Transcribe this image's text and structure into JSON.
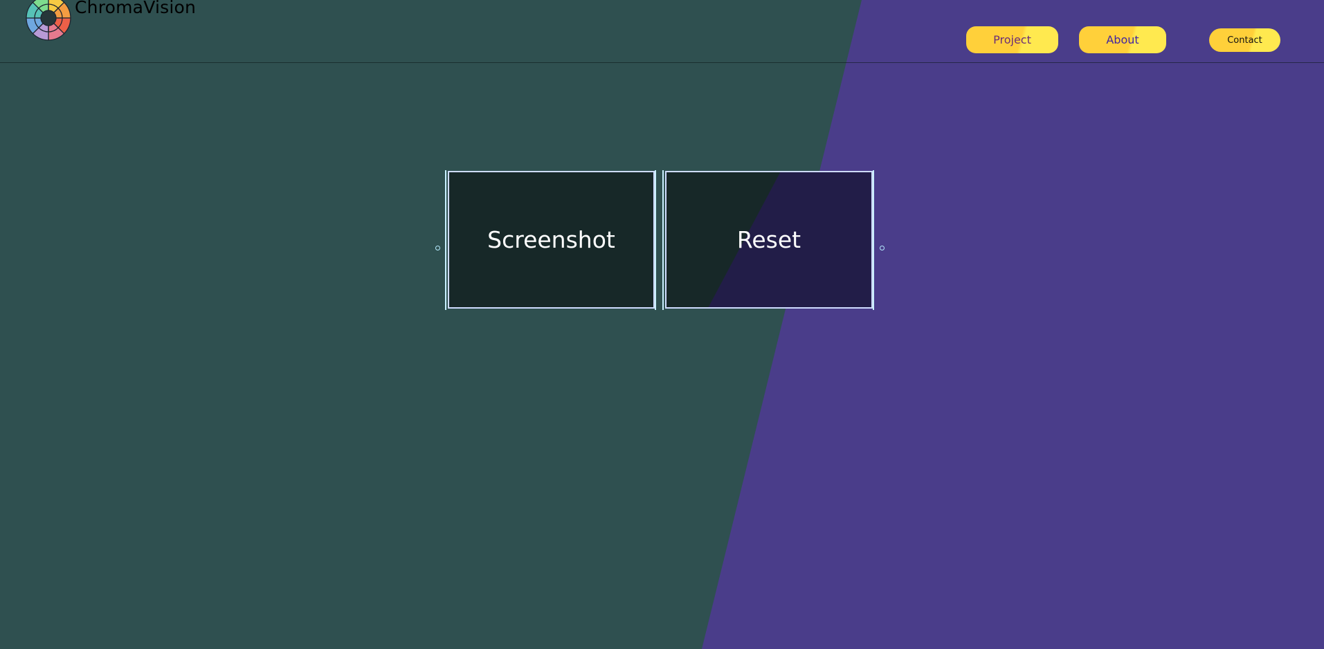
{
  "header": {
    "brand": {
      "name": "ChromaVision",
      "logo_icon": "color-wheel-icon"
    },
    "nav": {
      "project_label": "Project",
      "about_label": "About",
      "contact_label": "Contact"
    }
  },
  "controls": {
    "screenshot_label": "Screenshot",
    "reset_label": "Reset",
    "left_handle_icon": "selection-handle-icon",
    "right_handle_icon": "selection-handle-icon"
  },
  "colors": {
    "background_teal": "#2f5050",
    "background_purple": "#4a3d8a",
    "nav_yellow": "#ffd03a",
    "nav_highlight": "#ffe94f",
    "button_dark": "#172828",
    "button_purple_dark": "#221d48",
    "outline_blue": "#cfdcff",
    "text_white": "#ffffff"
  }
}
